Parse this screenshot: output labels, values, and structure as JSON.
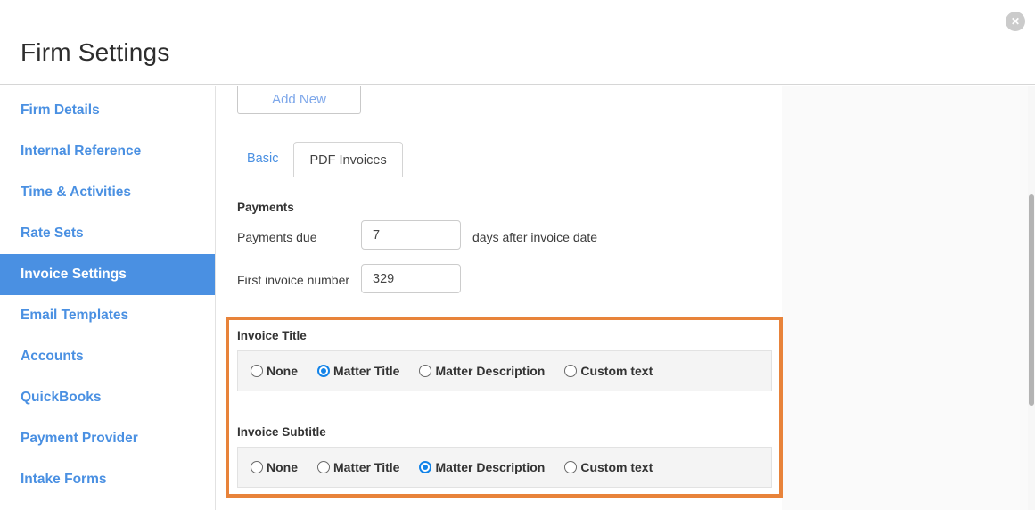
{
  "header": {
    "title": "Firm Settings"
  },
  "icons": {
    "close": "✕"
  },
  "sidebar": {
    "items": [
      {
        "label": "Firm Details",
        "selected": false
      },
      {
        "label": "Internal Reference",
        "selected": false
      },
      {
        "label": "Time & Activities",
        "selected": false
      },
      {
        "label": "Rate Sets",
        "selected": false
      },
      {
        "label": "Invoice Settings",
        "selected": true
      },
      {
        "label": "Email Templates",
        "selected": false
      },
      {
        "label": "Accounts",
        "selected": false
      },
      {
        "label": "QuickBooks",
        "selected": false
      },
      {
        "label": "Payment Provider",
        "selected": false
      },
      {
        "label": "Intake Forms",
        "selected": false
      }
    ]
  },
  "content": {
    "add_new_label": "Add New",
    "tabs": [
      {
        "label": "Basic",
        "active": false
      },
      {
        "label": "PDF Invoices",
        "active": true
      }
    ],
    "payments": {
      "heading": "Payments",
      "due": {
        "label": "Payments due",
        "value": "7",
        "suffix": "days after invoice date"
      },
      "first_invoice": {
        "label": "First invoice number",
        "value": "329"
      }
    },
    "radio_groups": [
      {
        "id": "invoice-title",
        "label": "Invoice Title",
        "options": [
          "None",
          "Matter Title",
          "Matter Description",
          "Custom text"
        ],
        "selected": "Matter Title"
      },
      {
        "id": "invoice-subtitle",
        "label": "Invoice Subtitle",
        "options": [
          "None",
          "Matter Title",
          "Matter Description",
          "Custom text"
        ],
        "selected": "Matter Description"
      }
    ]
  },
  "colors": {
    "accent_blue": "#4a90e2",
    "radio_selected_blue": "#1283e8",
    "highlight_orange": "#e8833a"
  }
}
